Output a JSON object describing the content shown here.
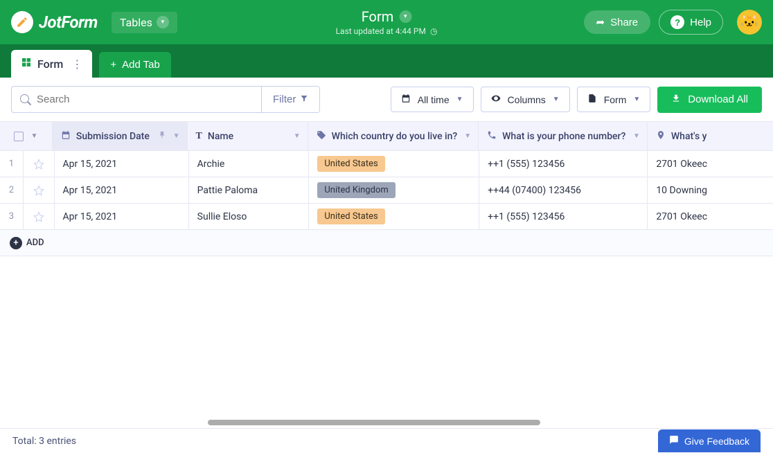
{
  "header": {
    "brand": "JotForm",
    "nav_tables": "Tables",
    "title": "Form",
    "last_updated": "Last updated at 4:44 PM",
    "share_label": "Share",
    "help_label": "Help"
  },
  "tabs": {
    "active_label": "Form",
    "add_tab_label": "Add Tab"
  },
  "toolbar": {
    "search_placeholder": "Search",
    "filter_label": "Filter",
    "alltime_label": "All time",
    "columns_label": "Columns",
    "form_label": "Form",
    "download_label": "Download All"
  },
  "columns": {
    "date": "Submission Date",
    "name": "Name",
    "country": "Which country do you live in?",
    "phone": "What is your phone number?",
    "address": "What's y"
  },
  "rows": [
    {
      "num": "1",
      "date": "Apr 15, 2021",
      "name": "Archie",
      "country": "United States",
      "country_class": "tag-us",
      "phone": "++1 (555) 123456",
      "address": "2701 Okeec"
    },
    {
      "num": "2",
      "date": "Apr 15, 2021",
      "name": "Pattie Paloma",
      "country": "United Kingdom",
      "country_class": "tag-uk",
      "phone": "++44 (07400) 123456",
      "address": "10 Downing"
    },
    {
      "num": "3",
      "date": "Apr 15, 2021",
      "name": "Sullie Eloso",
      "country": "United States",
      "country_class": "tag-us",
      "phone": "++1 (555) 123456",
      "address": "2701 Okeec"
    }
  ],
  "add_row_label": "ADD",
  "footer": {
    "total": "Total: 3 entries",
    "feedback": "Give Feedback"
  }
}
